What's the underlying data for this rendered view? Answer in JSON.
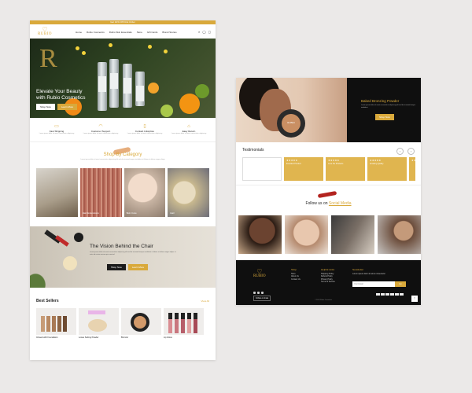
{
  "left_page": {
    "topbar": "Get 10% Off First Order",
    "logo": {
      "word": "RUBIO"
    },
    "nav": [
      "Home",
      "Rubio Cosmetics",
      "Rubio Skin Essentials",
      "Store",
      "Gift Cards",
      "Brand Stories"
    ],
    "hero": {
      "monogram": "R",
      "heading_line1": "Elevate Your Beauty",
      "heading_line2": "with Rubio Cosmetics",
      "btn_shop": "Shop Now",
      "btn_learn": "Learn More"
    },
    "features": [
      {
        "icon": "truck-icon",
        "glyph": "▭",
        "title": "Fast Shipping",
        "desc": "Lorem ipsum dolor sit amet consectetur adipiscing"
      },
      {
        "icon": "headset-icon",
        "glyph": "◠",
        "title": "Customer Support",
        "desc": "Lorem ipsum dolor sit amet consectetur adipiscing"
      },
      {
        "icon": "phone-icon",
        "glyph": "▯",
        "title": "Contact & Explore",
        "desc": "Lorem ipsum dolor sit amet consectetur adipiscing"
      },
      {
        "icon": "gift-icon",
        "glyph": "⌂",
        "title": "Easy Return",
        "desc": "Lorem ipsum dolor sit amet consectetur adipiscing"
      }
    ],
    "shop_category": {
      "title": "Shop By Category",
      "subtitle": "Lorem ipsum dolor sit amet consectetur adipiscing elit sed do eiusmod tempor incididunt ut labore et dolore magna aliqua"
    },
    "tiles": [
      "",
      "Hair Extensions",
      "Skin Care",
      "Hair"
    ],
    "vision": {
      "title": "The Vision Behind the Chair",
      "desc": "Lorem ipsum dolor sit amet consectetur adipiscing elit sed do eiusmod tempor incididunt ut labore et dolore magna aliqua ut enim ad minim veniam quis nostrud",
      "btn1": "Shop Now",
      "btn2": "Learn More"
    },
    "best_sellers": {
      "title": "Best Sellers",
      "view_all": "View All",
      "products": [
        {
          "name": "Infused with Foundation"
        },
        {
          "name": "Loose Setting Powder"
        },
        {
          "name": "Bronzer"
        },
        {
          "name": "Lip Gloss"
        }
      ]
    }
  },
  "right_page": {
    "banner": {
      "title": "Baked Bronzing Powder",
      "desc": "Lorem ipsum dolor sit amet consectetur adipiscing elit sed do eiusmod tempor incididunt",
      "btn": "Shop Now",
      "compact_text": "RUBIO"
    },
    "testimonials": {
      "title": "Testimonials",
      "prev": "‹",
      "next": "›",
      "cards": [
        {
          "stars": "",
          "text": ""
        },
        {
          "stars": "★★★★★",
          "text": "Excellent Product"
        },
        {
          "stars": "★★★★★",
          "text": "Love the Products"
        },
        {
          "stars": "★★★★★",
          "text": "Amazing Quality"
        },
        {
          "stars": "★★★★★",
          "text": ""
        }
      ]
    },
    "follow": {
      "prefix": "Follow us on",
      "link": "Social Media"
    },
    "footer": {
      "logo_word": "RUBIO",
      "follow_btn": "Follow on Insta",
      "col1": {
        "heading": "Shop",
        "items": [
          "Store",
          "About Us",
          "Contact Us"
        ]
      },
      "col2": {
        "heading": "Helpful Links",
        "items": [
          "Shipping Policy",
          "Refund Policy",
          "Privacy Policy",
          "Terms of Service"
        ]
      },
      "col3": {
        "heading": "Newsletter",
        "desc": "Lorem ipsum dolor sit amet consectetur"
      },
      "email_placeholder": "Your Email",
      "subscribe": "Go",
      "copyright": "© 2024 Rubio Cosmetics",
      "back_to_top": "↑"
    }
  },
  "colors": {
    "gold": "#d9a93b",
    "black": "#0f0f0f",
    "background": "#ebe9e8"
  }
}
